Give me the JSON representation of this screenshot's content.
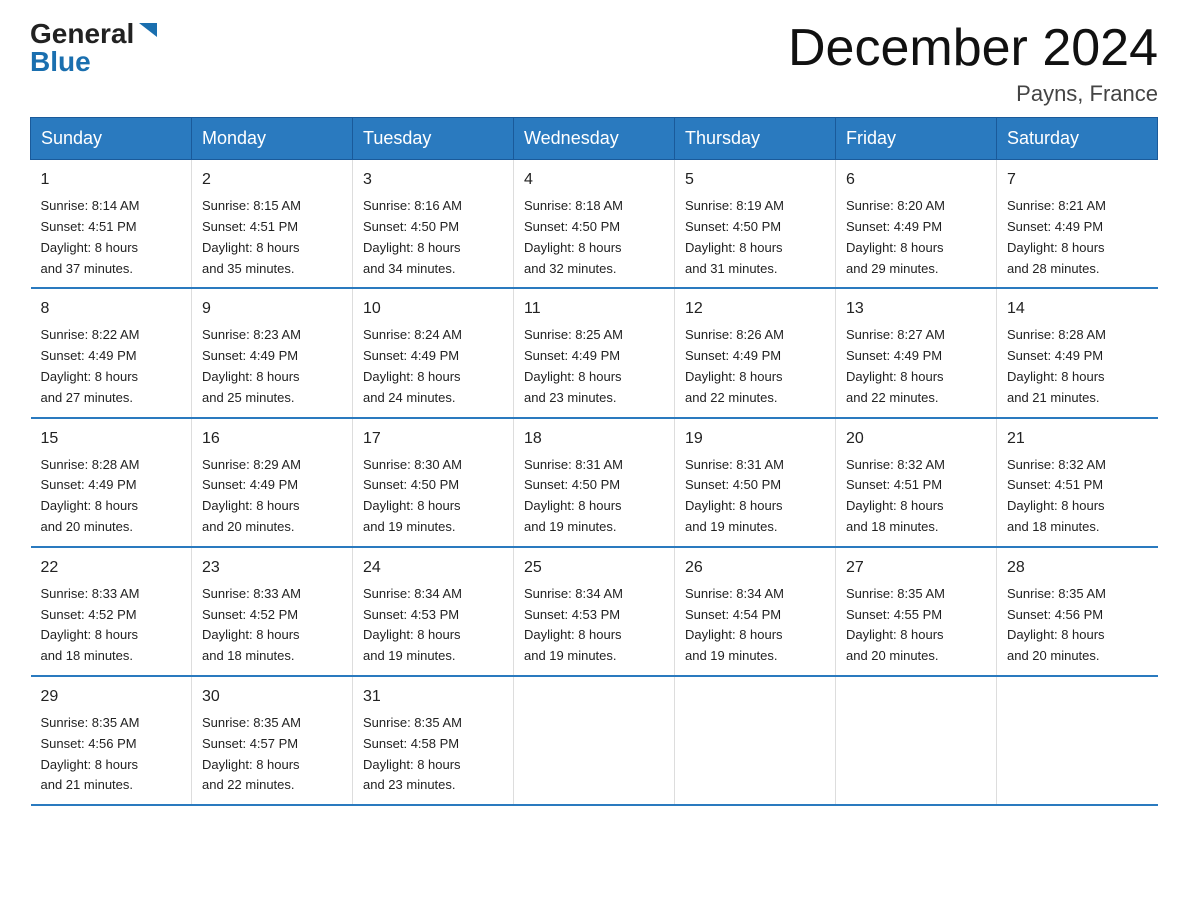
{
  "header": {
    "logo": {
      "general": "General",
      "blue": "Blue"
    },
    "title": "December 2024",
    "subtitle": "Payns, France"
  },
  "weekdays": [
    "Sunday",
    "Monday",
    "Tuesday",
    "Wednesday",
    "Thursday",
    "Friday",
    "Saturday"
  ],
  "weeks": [
    [
      {
        "day": "1",
        "sunrise": "8:14 AM",
        "sunset": "4:51 PM",
        "daylight": "8 hours and 37 minutes."
      },
      {
        "day": "2",
        "sunrise": "8:15 AM",
        "sunset": "4:51 PM",
        "daylight": "8 hours and 35 minutes."
      },
      {
        "day": "3",
        "sunrise": "8:16 AM",
        "sunset": "4:50 PM",
        "daylight": "8 hours and 34 minutes."
      },
      {
        "day": "4",
        "sunrise": "8:18 AM",
        "sunset": "4:50 PM",
        "daylight": "8 hours and 32 minutes."
      },
      {
        "day": "5",
        "sunrise": "8:19 AM",
        "sunset": "4:50 PM",
        "daylight": "8 hours and 31 minutes."
      },
      {
        "day": "6",
        "sunrise": "8:20 AM",
        "sunset": "4:49 PM",
        "daylight": "8 hours and 29 minutes."
      },
      {
        "day": "7",
        "sunrise": "8:21 AM",
        "sunset": "4:49 PM",
        "daylight": "8 hours and 28 minutes."
      }
    ],
    [
      {
        "day": "8",
        "sunrise": "8:22 AM",
        "sunset": "4:49 PM",
        "daylight": "8 hours and 27 minutes."
      },
      {
        "day": "9",
        "sunrise": "8:23 AM",
        "sunset": "4:49 PM",
        "daylight": "8 hours and 25 minutes."
      },
      {
        "day": "10",
        "sunrise": "8:24 AM",
        "sunset": "4:49 PM",
        "daylight": "8 hours and 24 minutes."
      },
      {
        "day": "11",
        "sunrise": "8:25 AM",
        "sunset": "4:49 PM",
        "daylight": "8 hours and 23 minutes."
      },
      {
        "day": "12",
        "sunrise": "8:26 AM",
        "sunset": "4:49 PM",
        "daylight": "8 hours and 22 minutes."
      },
      {
        "day": "13",
        "sunrise": "8:27 AM",
        "sunset": "4:49 PM",
        "daylight": "8 hours and 22 minutes."
      },
      {
        "day": "14",
        "sunrise": "8:28 AM",
        "sunset": "4:49 PM",
        "daylight": "8 hours and 21 minutes."
      }
    ],
    [
      {
        "day": "15",
        "sunrise": "8:28 AM",
        "sunset": "4:49 PM",
        "daylight": "8 hours and 20 minutes."
      },
      {
        "day": "16",
        "sunrise": "8:29 AM",
        "sunset": "4:49 PM",
        "daylight": "8 hours and 20 minutes."
      },
      {
        "day": "17",
        "sunrise": "8:30 AM",
        "sunset": "4:50 PM",
        "daylight": "8 hours and 19 minutes."
      },
      {
        "day": "18",
        "sunrise": "8:31 AM",
        "sunset": "4:50 PM",
        "daylight": "8 hours and 19 minutes."
      },
      {
        "day": "19",
        "sunrise": "8:31 AM",
        "sunset": "4:50 PM",
        "daylight": "8 hours and 19 minutes."
      },
      {
        "day": "20",
        "sunrise": "8:32 AM",
        "sunset": "4:51 PM",
        "daylight": "8 hours and 18 minutes."
      },
      {
        "day": "21",
        "sunrise": "8:32 AM",
        "sunset": "4:51 PM",
        "daylight": "8 hours and 18 minutes."
      }
    ],
    [
      {
        "day": "22",
        "sunrise": "8:33 AM",
        "sunset": "4:52 PM",
        "daylight": "8 hours and 18 minutes."
      },
      {
        "day": "23",
        "sunrise": "8:33 AM",
        "sunset": "4:52 PM",
        "daylight": "8 hours and 18 minutes."
      },
      {
        "day": "24",
        "sunrise": "8:34 AM",
        "sunset": "4:53 PM",
        "daylight": "8 hours and 19 minutes."
      },
      {
        "day": "25",
        "sunrise": "8:34 AM",
        "sunset": "4:53 PM",
        "daylight": "8 hours and 19 minutes."
      },
      {
        "day": "26",
        "sunrise": "8:34 AM",
        "sunset": "4:54 PM",
        "daylight": "8 hours and 19 minutes."
      },
      {
        "day": "27",
        "sunrise": "8:35 AM",
        "sunset": "4:55 PM",
        "daylight": "8 hours and 20 minutes."
      },
      {
        "day": "28",
        "sunrise": "8:35 AM",
        "sunset": "4:56 PM",
        "daylight": "8 hours and 20 minutes."
      }
    ],
    [
      {
        "day": "29",
        "sunrise": "8:35 AM",
        "sunset": "4:56 PM",
        "daylight": "8 hours and 21 minutes."
      },
      {
        "day": "30",
        "sunrise": "8:35 AM",
        "sunset": "4:57 PM",
        "daylight": "8 hours and 22 minutes."
      },
      {
        "day": "31",
        "sunrise": "8:35 AM",
        "sunset": "4:58 PM",
        "daylight": "8 hours and 23 minutes."
      },
      null,
      null,
      null,
      null
    ]
  ],
  "labels": {
    "sunrise": "Sunrise:",
    "sunset": "Sunset:",
    "daylight": "Daylight:"
  }
}
